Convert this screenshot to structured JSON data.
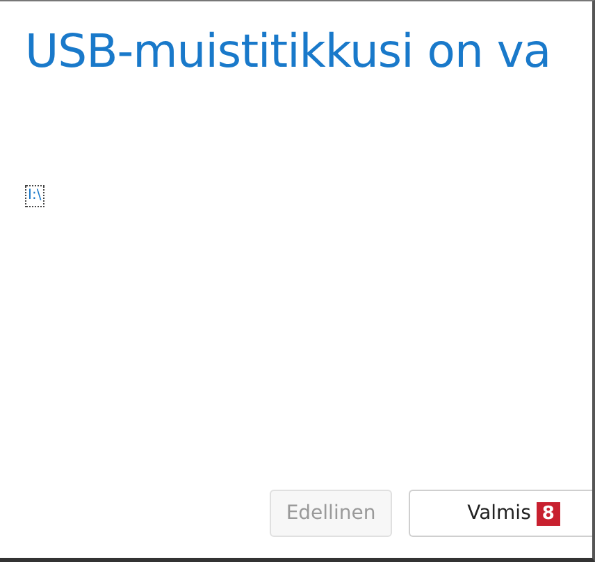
{
  "title": "USB-muistitikkusi on va",
  "drive_link": {
    "label": "I:\\",
    "focused": true
  },
  "buttons": [
    {
      "label": "Edellinen",
      "disabled": true
    },
    {
      "label": "Valmis",
      "disabled": false,
      "badge": "8"
    }
  ]
}
